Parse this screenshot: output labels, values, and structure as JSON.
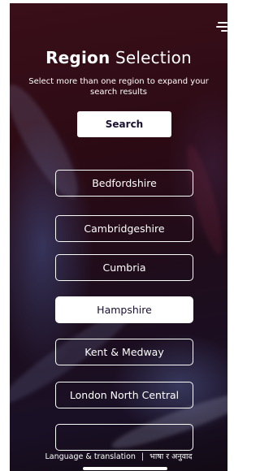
{
  "header": {
    "title_bold": "Region",
    "title_light": "Selection",
    "subtitle": "Select more than one region to expand your search results"
  },
  "search": {
    "label": "Search"
  },
  "regions": [
    {
      "label": "Bedfordshire",
      "selected": false
    },
    {
      "label": "Cambridgeshire",
      "selected": false
    },
    {
      "label": "Cumbria",
      "selected": false
    },
    {
      "label": "Hampshire",
      "selected": true
    },
    {
      "label": "Kent & Medway",
      "selected": false
    },
    {
      "label": "London North Central",
      "selected": false
    },
    {
      "label": "",
      "selected": false
    }
  ],
  "footer": {
    "language": "Language & translation",
    "separator": "|",
    "translation": "भाषा र अनुवाद"
  },
  "colors": {
    "background_top": "#3a0f19",
    "background_bottom": "#1a1026",
    "text": "#ffffff",
    "selected_fill": "#ffffff",
    "selected_text": "#1a1030"
  }
}
